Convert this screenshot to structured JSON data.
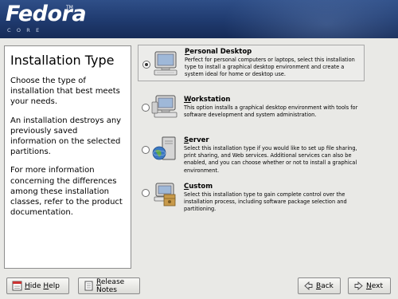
{
  "header": {
    "logo_word": "Fedora",
    "logo_tm": "TM",
    "logo_sub": "CORE"
  },
  "help": {
    "title": "Installation Type",
    "paragraphs": [
      "Choose the type of installation that best meets your needs.",
      "An installation destroys any previously saved information on the selected partitions.",
      "For more information concerning the differences among these installation classes, refer to the product documentation."
    ]
  },
  "options": [
    {
      "title_mnemonic": "P",
      "title_rest": "ersonal Desktop",
      "description": "Perfect for personal computers or laptops, select this installation type to install a graphical desktop environment and create a system ideal for home or desktop use.",
      "selected": true,
      "icon": "desktop-computer-icon"
    },
    {
      "title_mnemonic": "W",
      "title_rest": "orkstation",
      "description": "This option installs a graphical desktop environment with tools for software development and system administration.",
      "selected": false,
      "icon": "workstation-icon"
    },
    {
      "title_mnemonic": "S",
      "title_rest": "erver",
      "description": "Select this installation type if you would like to set up file sharing, print sharing, and Web services. Additional services can also be enabled, and you can choose whether or not to install a graphical environment.",
      "selected": false,
      "icon": "server-icon"
    },
    {
      "title_mnemonic": "C",
      "title_rest": "ustom",
      "description": "Select this installation type to gain complete control over the installation process, including software package selection and partitioning.",
      "selected": false,
      "icon": "custom-package-icon"
    }
  ],
  "buttons": {
    "hide_help": {
      "mnemonic": "H",
      "rest": "ide ",
      "mnemonic2": "H",
      "rest2": "elp"
    },
    "release_notes": {
      "mnemonic": "R",
      "rest": "elease Notes"
    },
    "back": {
      "mnemonic": "B",
      "rest": "ack"
    },
    "next": {
      "mnemonic": "N",
      "rest": "ext"
    }
  },
  "colors": {
    "banner": "#1f3a6e",
    "background": "#e9e9e6"
  }
}
